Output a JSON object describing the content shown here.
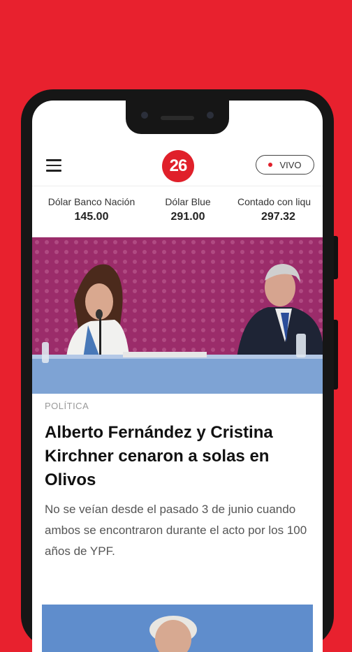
{
  "header": {
    "logo_text": "26",
    "live_label": "VIVO"
  },
  "ticker": [
    {
      "label": "Dólar Banco Nación",
      "value": "145.00"
    },
    {
      "label": "Dólar Blue",
      "value": "291.00"
    },
    {
      "label": "Contado con liqu",
      "value": "297.32"
    }
  ],
  "article": {
    "category": "POLÍTICA",
    "headline": "Alberto Fernández y Cristina Kirchner cenaron a solas en Olivos",
    "summary": "No se veían desde el pasado 3 de junio cuando ambos se encontraron durante el acto por los 100 años de YPF."
  },
  "colors": {
    "brand": "#e8212e",
    "live_dot": "#e0202a"
  },
  "icons": {
    "menu": "hamburger-icon",
    "live": "live-dot-icon"
  }
}
